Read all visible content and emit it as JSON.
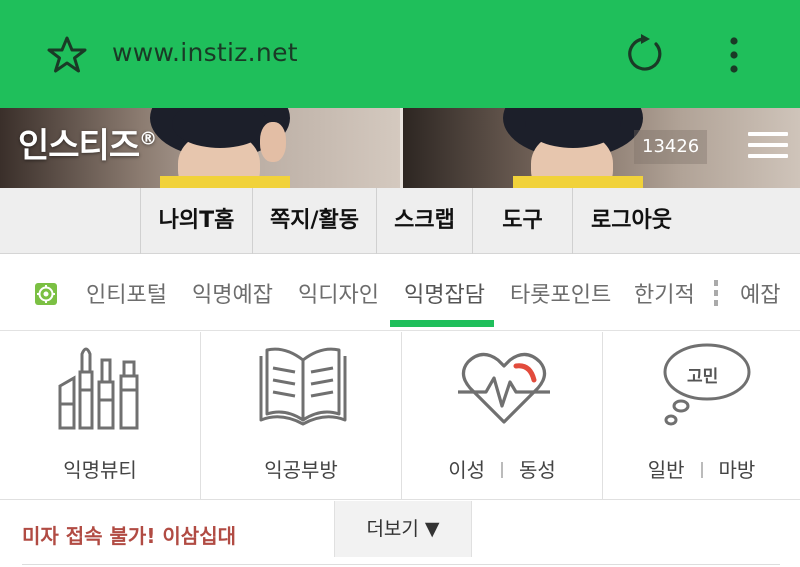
{
  "browser": {
    "url": "www.instiz.net",
    "accent_color": "#1fbf5b",
    "icons": [
      "star-icon",
      "reload-icon",
      "overflow-menu-icon"
    ]
  },
  "banner": {
    "logo": "인스티즈",
    "logo_mark": "®",
    "count": "13426"
  },
  "top_menu": {
    "items": [
      "나의T홈",
      "쪽지/활동",
      "스크랩",
      "도구",
      "로그아웃"
    ]
  },
  "categories": {
    "items": [
      "인티포털",
      "익명예잡",
      "익디자인",
      "익명잡담",
      "타롯포인트",
      "한기적",
      "예잡"
    ],
    "active": "익명잡담"
  },
  "boards": {
    "beauty": "익명뷰티",
    "study": "익공부방",
    "love_left": "이성",
    "love_right": "동성",
    "worry_bubble": "고민",
    "worry_left": "일반",
    "worry_right": "마방"
  },
  "footer": {
    "notice": "미자 접속 불가! 이삼십대",
    "more": "더보기 ▼"
  }
}
